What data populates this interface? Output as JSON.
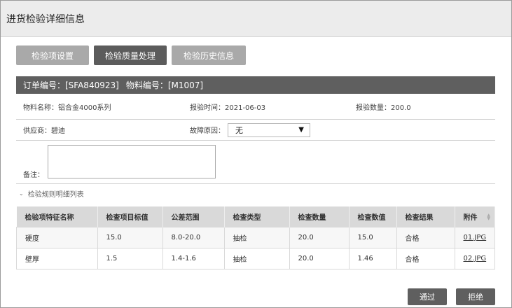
{
  "window": {
    "title": "进货检验详细信息"
  },
  "tabs": [
    {
      "label": "检验项设置"
    },
    {
      "label": "检验质量处理"
    },
    {
      "label": "检验历史信息"
    }
  ],
  "order": {
    "order_no": "订单编号：[SFA840923]",
    "material_no": "物料编号：[M1007]"
  },
  "info": {
    "material_name": "物料名称：铝合金4000系列",
    "report_time": "报验时间：2021-06-03",
    "report_qty": "报验数量：200.0",
    "supplier": "供应商：碧迪",
    "fault_label": "故障原因：",
    "fault_value": "无",
    "note_label": "备注："
  },
  "section": {
    "title": "检验规则明细列表"
  },
  "table": {
    "headers": [
      "检验项特征名称",
      "检查项目标值",
      "公差范围",
      "检查类型",
      "检查数量",
      "检查数值",
      "检查结果",
      "附件"
    ],
    "rows": [
      [
        "硬度",
        "15.0",
        "8.0-20.0",
        "抽检",
        "20.0",
        "15.0",
        "合格",
        "01.JPG"
      ],
      [
        "壁厚",
        "1.5",
        "1.4-1.6",
        "抽检",
        "20.0",
        "1.46",
        "合格",
        "02.JPG"
      ]
    ]
  },
  "buttons": {
    "pass": "通过",
    "reject": "拒绝"
  }
}
